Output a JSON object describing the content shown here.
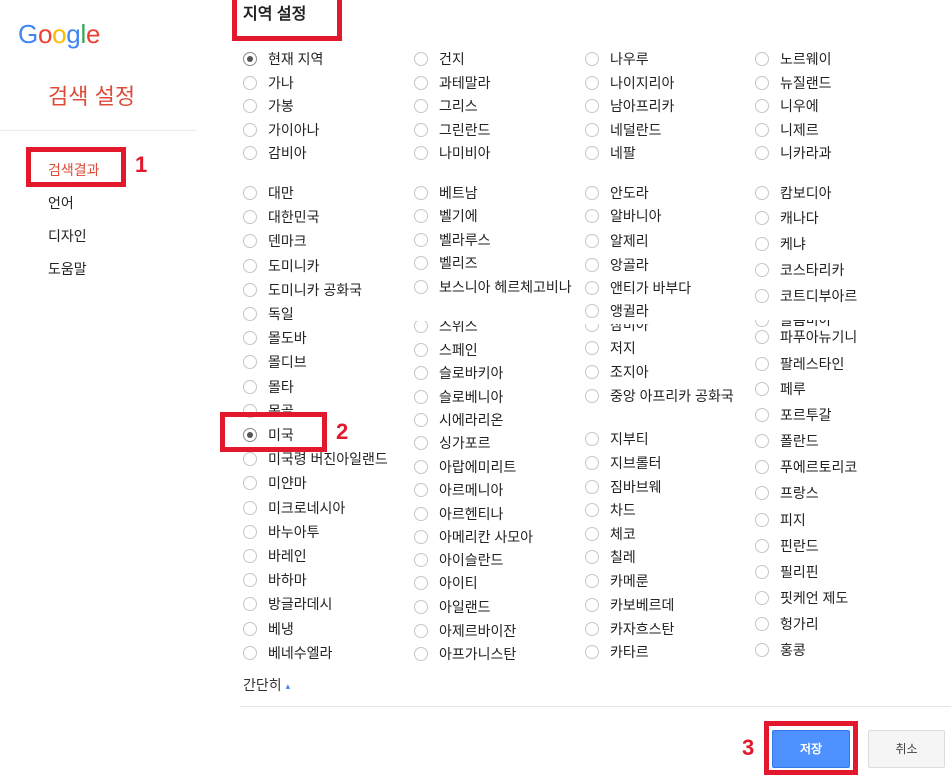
{
  "logo": {
    "text": "Google",
    "letter_colors": [
      "#4285F4",
      "#EA4335",
      "#FBBC05",
      "#4285F4",
      "#34A853",
      "#EA4335"
    ]
  },
  "sidebar": {
    "title": "검색 설정",
    "items": [
      {
        "label": "검색결과",
        "active": true
      },
      {
        "label": "언어",
        "active": false
      },
      {
        "label": "디자인",
        "active": false
      },
      {
        "label": "도움말",
        "active": false
      }
    ]
  },
  "section": {
    "title": "지역 설정"
  },
  "regions": {
    "selected": [
      "현재 지역",
      "미국"
    ],
    "group1": [
      [
        "현재 지역",
        "가나",
        "가봉",
        "가이아나",
        "감비아"
      ],
      [
        "건지",
        "과테말라",
        "그리스",
        "그린란드",
        "나미비아"
      ],
      [
        "나우루",
        "나이지리아",
        "남아프리카",
        "네덜란드",
        "네팔"
      ],
      [
        "노르웨이",
        "뉴질랜드",
        "니우에",
        "니제르",
        "니카라과"
      ]
    ],
    "group2": [
      [
        "대만",
        "대한민국",
        "덴마크",
        "도미니카",
        "도미니카 공화국",
        "독일",
        "몰도바",
        "몰디브",
        "몰타",
        "몽골",
        "미국",
        "미국령 버진아일랜드",
        "미얀마",
        "미크로네시아",
        "바누아투",
        "바레인",
        "바하마",
        "방글라데시",
        "베냉",
        "베네수엘라"
      ],
      [
        "베트남",
        "벨기에",
        "벨라루스",
        "벨리즈",
        "보스니아 헤르체고비나",
        "스위스",
        "스페인",
        "슬로바키아",
        "슬로베니아",
        "시에라리온",
        "싱가포르",
        "아랍에미리트",
        "아르메니아",
        "아르헨티나",
        "아메리칸 사모아",
        "아이슬란드",
        "아이티",
        "아일랜드",
        "아제르바이잔",
        "아프가니스탄"
      ],
      [
        "안도라",
        "알바니아",
        "알제리",
        "앙골라",
        "앤티가 바부다",
        "앵귈라",
        "잠비아",
        "저지",
        "조지아",
        "중앙 아프리카 공화국",
        "지부티",
        "지브롤터",
        "짐바브웨",
        "차드",
        "체코",
        "칠레",
        "카메룬",
        "카보베르데",
        "카자흐스탄",
        "카타르"
      ],
      [
        "캄보디아",
        "캐나다",
        "케냐",
        "코스타리카",
        "코트디부아르",
        "콜롬비아",
        "파푸아뉴기니",
        "팔레스타인",
        "페루",
        "포르투갈",
        "폴란드",
        "푸에르토리코",
        "프랑스",
        "피지",
        "핀란드",
        "필리핀",
        "핏케언 제도",
        "헝가리",
        "홍콩"
      ]
    ]
  },
  "collapse_link": {
    "label": "간단히",
    "arrow_glyph": "▴",
    "arrow_icon": "triangle-up-icon"
  },
  "buttons": {
    "save": "저장",
    "cancel": "취소"
  },
  "annotations": {
    "step1": "1",
    "step2": "2",
    "step3": "3"
  },
  "colors": {
    "accent_red": "#dd4b39",
    "annotation_red": "#e3182d",
    "primary_blue": "#4d90fe",
    "text": "#222222"
  }
}
